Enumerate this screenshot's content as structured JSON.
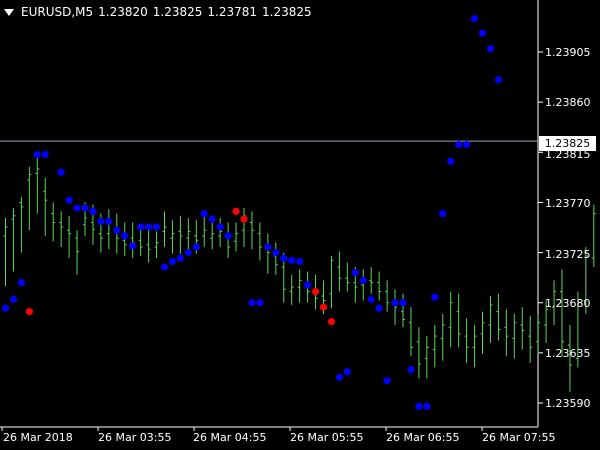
{
  "header": {
    "symbol": "EURUSD,M5",
    "open": "1.23820",
    "high": "1.23825",
    "low": "1.23781",
    "close": "1.23825"
  },
  "current_price": "1.23825",
  "colors": {
    "background": "#000000",
    "bars": "#5fd35f",
    "dot_up": "#0000ff",
    "dot_down": "#ff0000",
    "grid_line": "#9aa3b5",
    "axis": "#ffffff"
  },
  "chart_data": {
    "type": "ohlc",
    "price_ticks": [
      "1.23905",
      "1.23860",
      "1.23815",
      "1.23770",
      "1.23725",
      "1.23680",
      "1.23635",
      "1.23590"
    ],
    "time_ticks": [
      "26 Mar 2018",
      "26 Mar 03:55",
      "26 Mar 04:55",
      "26 Mar 05:55",
      "26 Mar 06:55",
      "26 Mar 07:55"
    ],
    "bars": [
      [
        1.2374,
        1.23756,
        1.23695,
        1.23748
      ],
      [
        1.23755,
        1.23765,
        1.23708,
        1.23758
      ],
      [
        1.2377,
        1.23775,
        1.23725,
        1.23766
      ],
      [
        1.2379,
        1.23802,
        1.23745,
        1.23795
      ],
      [
        1.23796,
        1.2381,
        1.2376,
        1.238
      ],
      [
        1.2378,
        1.23792,
        1.2374,
        1.23772
      ],
      [
        1.2376,
        1.2377,
        1.23735,
        1.23752
      ],
      [
        1.23752,
        1.23762,
        1.2373,
        1.23748
      ],
      [
        1.23745,
        1.23758,
        1.2372,
        1.23742
      ],
      [
        1.23738,
        1.23745,
        1.23705,
        1.23726
      ],
      [
        1.2375,
        1.2377,
        1.2374,
        1.23756
      ],
      [
        1.23752,
        1.23768,
        1.23732,
        1.23746
      ],
      [
        1.23742,
        1.2376,
        1.23725,
        1.23738
      ],
      [
        1.23742,
        1.23764,
        1.23728,
        1.23752
      ],
      [
        1.23744,
        1.2376,
        1.23724,
        1.23738
      ],
      [
        1.23736,
        1.23752,
        1.23722,
        1.23732
      ],
      [
        1.23738,
        1.23752,
        1.2372,
        1.23734
      ],
      [
        1.23736,
        1.2375,
        1.23722,
        1.2373
      ],
      [
        1.23732,
        1.23746,
        1.23716,
        1.23728
      ],
      [
        1.2373,
        1.23744,
        1.2372,
        1.23734
      ],
      [
        1.23744,
        1.23762,
        1.2373,
        1.23748
      ],
      [
        1.23738,
        1.23754,
        1.23724,
        1.23742
      ],
      [
        1.23744,
        1.23758,
        1.23724,
        1.2374
      ],
      [
        1.23738,
        1.23756,
        1.23726,
        1.23744
      ],
      [
        1.2374,
        1.23754,
        1.23724,
        1.23736
      ],
      [
        1.2374,
        1.2376,
        1.2373,
        1.23745
      ],
      [
        1.23738,
        1.23754,
        1.23728,
        1.23742
      ],
      [
        1.2374,
        1.23756,
        1.2373,
        1.23744
      ],
      [
        1.23738,
        1.23752,
        1.2372,
        1.2373
      ],
      [
        1.23735,
        1.23752,
        1.23726,
        1.23742
      ],
      [
        1.23745,
        1.23765,
        1.2373,
        1.23758
      ],
      [
        1.23752,
        1.23762,
        1.23728,
        1.23745
      ],
      [
        1.23742,
        1.23752,
        1.23718,
        1.2373
      ],
      [
        1.2373,
        1.23742,
        1.23706,
        1.23725
      ],
      [
        1.23722,
        1.23734,
        1.23705,
        1.23714
      ],
      [
        1.23712,
        1.23725,
        1.2368,
        1.23692
      ],
      [
        1.2369,
        1.23705,
        1.23678,
        1.23694
      ],
      [
        1.23694,
        1.2371,
        1.2368,
        1.237
      ],
      [
        1.23695,
        1.23708,
        1.2368,
        1.2369
      ],
      [
        1.2369,
        1.23705,
        1.23674,
        1.23684
      ],
      [
        1.23686,
        1.237,
        1.2367,
        1.23682
      ],
      [
        1.23688,
        1.23722,
        1.23675,
        1.23718
      ],
      [
        1.23712,
        1.23726,
        1.2369,
        1.23702
      ],
      [
        1.23702,
        1.23716,
        1.2369,
        1.23698
      ],
      [
        1.23698,
        1.23712,
        1.2368,
        1.23694
      ],
      [
        1.23696,
        1.2371,
        1.23682,
        1.237
      ],
      [
        1.237,
        1.23712,
        1.23688,
        1.23698
      ],
      [
        1.23698,
        1.23708,
        1.23682,
        1.2369
      ],
      [
        1.2369,
        1.237,
        1.23672,
        1.2368
      ],
      [
        1.23678,
        1.23692,
        1.2366,
        1.23676
      ],
      [
        1.23672,
        1.23688,
        1.23658,
        1.23665
      ],
      [
        1.23662,
        1.23676,
        1.23632,
        1.2364
      ],
      [
        1.23645,
        1.23658,
        1.23612,
        1.23625
      ],
      [
        1.2363,
        1.2365,
        1.23612,
        1.2364
      ],
      [
        1.23638,
        1.2366,
        1.23622,
        1.2365
      ],
      [
        1.23648,
        1.2367,
        1.23628,
        1.2366
      ],
      [
        1.23658,
        1.2369,
        1.2364,
        1.2368
      ],
      [
        1.23672,
        1.23688,
        1.2364,
        1.23652
      ],
      [
        1.2365,
        1.23666,
        1.23626,
        1.2364
      ],
      [
        1.2364,
        1.2366,
        1.23622,
        1.2365
      ],
      [
        1.23652,
        1.23672,
        1.23634,
        1.23662
      ],
      [
        1.2366,
        1.23686,
        1.23644,
        1.23678
      ],
      [
        1.23672,
        1.23688,
        1.23646,
        1.23656
      ],
      [
        1.23658,
        1.23674,
        1.23632,
        1.2365
      ],
      [
        1.23648,
        1.2367,
        1.2363,
        1.23662
      ],
      [
        1.2366,
        1.23676,
        1.23638,
        1.23655
      ],
      [
        1.2365,
        1.23668,
        1.23626,
        1.2364
      ],
      [
        1.23645,
        1.2367,
        1.23634,
        1.23662
      ],
      [
        1.2366,
        1.23682,
        1.23644,
        1.23674
      ],
      [
        1.23676,
        1.237,
        1.2366,
        1.2369
      ],
      [
        1.2369,
        1.2371,
        1.23632,
        1.23645
      ],
      [
        1.23642,
        1.2366,
        1.236,
        1.23624
      ],
      [
        1.2363,
        1.2369,
        1.23622,
        1.2368
      ],
      [
        1.23682,
        1.2373,
        1.2367,
        1.23722
      ],
      [
        1.2372,
        1.23768,
        1.23712,
        1.2376
      ],
      [
        1.2376,
        1.2379,
        1.2375,
        1.23782
      ],
      [
        1.23782,
        1.23818,
        1.2377,
        1.23805
      ],
      [
        1.23805,
        1.2388,
        1.23795,
        1.2387
      ],
      [
        1.23868,
        1.239,
        1.2384,
        1.23862
      ],
      [
        1.2386,
        1.23878,
        1.2383,
        1.23856
      ],
      [
        1.23856,
        1.23872,
        1.23828,
        1.23846
      ],
      [
        1.23846,
        1.2386,
        1.23815,
        1.23836
      ],
      [
        1.23838,
        1.23855,
        1.23812,
        1.2383
      ],
      [
        1.23832,
        1.23848,
        1.238,
        1.23822
      ],
      [
        1.23822,
        1.23836,
        1.23795,
        1.2381
      ],
      [
        1.2381,
        1.23826,
        1.23781,
        1.23825
      ]
    ],
    "dots": [
      {
        "bar": 0,
        "price": 1.23675,
        "color": "up"
      },
      {
        "bar": 1,
        "price": 1.23683,
        "color": "up"
      },
      {
        "bar": 2,
        "price": 1.23698,
        "color": "up"
      },
      {
        "bar": 3,
        "price": 1.23672,
        "color": "down"
      },
      {
        "bar": 4,
        "price": 1.23813,
        "color": "up"
      },
      {
        "bar": 5,
        "price": 1.23813,
        "color": "up"
      },
      {
        "bar": 7,
        "price": 1.23797,
        "color": "up"
      },
      {
        "bar": 8,
        "price": 1.23772,
        "color": "up"
      },
      {
        "bar": 9,
        "price": 1.23765,
        "color": "up"
      },
      {
        "bar": 10,
        "price": 1.23765,
        "color": "up"
      },
      {
        "bar": 11,
        "price": 1.23762,
        "color": "up"
      },
      {
        "bar": 12,
        "price": 1.23753,
        "color": "up"
      },
      {
        "bar": 13,
        "price": 1.23753,
        "color": "up"
      },
      {
        "bar": 14,
        "price": 1.23745,
        "color": "up"
      },
      {
        "bar": 15,
        "price": 1.2374,
        "color": "up"
      },
      {
        "bar": 16,
        "price": 1.23731,
        "color": "up"
      },
      {
        "bar": 17,
        "price": 1.23748,
        "color": "up"
      },
      {
        "bar": 18,
        "price": 1.23748,
        "color": "up"
      },
      {
        "bar": 19,
        "price": 1.23748,
        "color": "up"
      },
      {
        "bar": 20,
        "price": 1.23712,
        "color": "up"
      },
      {
        "bar": 21,
        "price": 1.23717,
        "color": "up"
      },
      {
        "bar": 22,
        "price": 1.2372,
        "color": "up"
      },
      {
        "bar": 23,
        "price": 1.23725,
        "color": "up"
      },
      {
        "bar": 24,
        "price": 1.2373,
        "color": "up"
      },
      {
        "bar": 25,
        "price": 1.2376,
        "color": "up"
      },
      {
        "bar": 26,
        "price": 1.23755,
        "color": "up"
      },
      {
        "bar": 27,
        "price": 1.23748,
        "color": "up"
      },
      {
        "bar": 28,
        "price": 1.2374,
        "color": "up"
      },
      {
        "bar": 29,
        "price": 1.23762,
        "color": "down"
      },
      {
        "bar": 30,
        "price": 1.23755,
        "color": "down"
      },
      {
        "bar": 31,
        "price": 1.2368,
        "color": "up"
      },
      {
        "bar": 32,
        "price": 1.2368,
        "color": "up"
      },
      {
        "bar": 33,
        "price": 1.2373,
        "color": "up"
      },
      {
        "bar": 34,
        "price": 1.23725,
        "color": "up"
      },
      {
        "bar": 35,
        "price": 1.2372,
        "color": "up"
      },
      {
        "bar": 36,
        "price": 1.23718,
        "color": "up"
      },
      {
        "bar": 37,
        "price": 1.23717,
        "color": "up"
      },
      {
        "bar": 38,
        "price": 1.23696,
        "color": "up"
      },
      {
        "bar": 39,
        "price": 1.2369,
        "color": "down"
      },
      {
        "bar": 40,
        "price": 1.23676,
        "color": "down"
      },
      {
        "bar": 41,
        "price": 1.23663,
        "color": "down"
      },
      {
        "bar": 42,
        "price": 1.23613,
        "color": "up"
      },
      {
        "bar": 43,
        "price": 1.23618,
        "color": "up"
      },
      {
        "bar": 44,
        "price": 1.23707,
        "color": "up"
      },
      {
        "bar": 45,
        "price": 1.237,
        "color": "up"
      },
      {
        "bar": 46,
        "price": 1.23683,
        "color": "up"
      },
      {
        "bar": 47,
        "price": 1.23675,
        "color": "up"
      },
      {
        "bar": 48,
        "price": 1.2361,
        "color": "up"
      },
      {
        "bar": 49,
        "price": 1.2368,
        "color": "up"
      },
      {
        "bar": 50,
        "price": 1.2368,
        "color": "up"
      },
      {
        "bar": 51,
        "price": 1.2362,
        "color": "up"
      },
      {
        "bar": 52,
        "price": 1.23587,
        "color": "up"
      },
      {
        "bar": 53,
        "price": 1.23587,
        "color": "up"
      },
      {
        "bar": 54,
        "price": 1.23685,
        "color": "up"
      },
      {
        "bar": 55,
        "price": 1.2376,
        "color": "up"
      },
      {
        "bar": 56,
        "price": 1.23807,
        "color": "up"
      },
      {
        "bar": 57,
        "price": 1.23822,
        "color": "up"
      },
      {
        "bar": 58,
        "price": 1.23822,
        "color": "up"
      },
      {
        "bar": 59,
        "price": 1.23935,
        "color": "up"
      },
      {
        "bar": 60,
        "price": 1.23922,
        "color": "up"
      },
      {
        "bar": 61,
        "price": 1.23908,
        "color": "up"
      },
      {
        "bar": 62,
        "price": 1.2388,
        "color": "up"
      }
    ]
  }
}
